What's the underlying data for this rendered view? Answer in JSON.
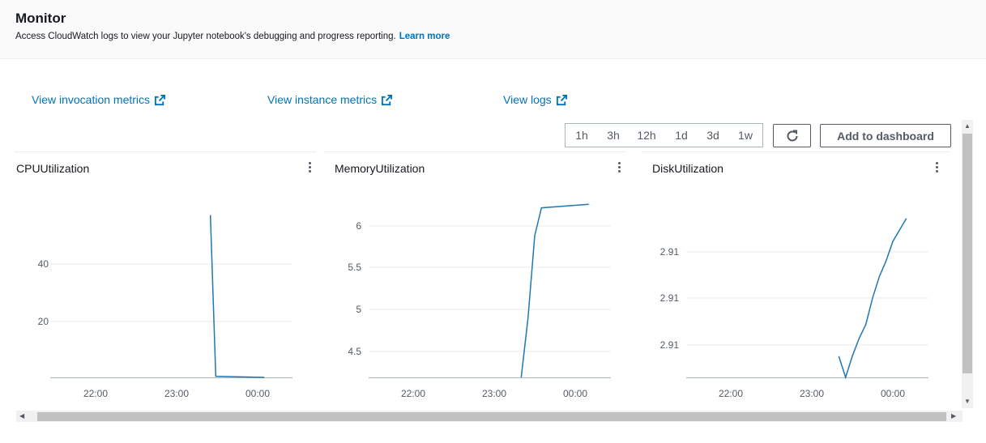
{
  "header": {
    "title": "Monitor",
    "subtitle": "Access CloudWatch logs to view your Jupyter notebook's debugging and progress reporting.",
    "learn_more": "Learn more"
  },
  "links": {
    "invocation": "View invocation metrics",
    "instance": "View instance metrics",
    "logs": "View logs"
  },
  "time_range": [
    "1h",
    "3h",
    "12h",
    "1d",
    "3d",
    "1w"
  ],
  "toolbar": {
    "refresh_icon": "refresh-icon",
    "add_to_dashboard": "Add to dashboard"
  },
  "colors": {
    "line": "#1f77b4",
    "link": "#0073bb"
  },
  "chart_data": [
    {
      "type": "line",
      "title": "CPUUtilization",
      "x_ticks": [
        "22:00",
        "23:00",
        "00:00"
      ],
      "y_ticks": [
        "20",
        "40"
      ],
      "x": [
        "23:25",
        "23:29",
        "00:05"
      ],
      "values": [
        57,
        0.4,
        0
      ],
      "ylim": [
        0,
        62
      ]
    },
    {
      "type": "line",
      "title": "MemoryUtilization",
      "x_ticks": [
        "22:00",
        "23:00",
        "00:00"
      ],
      "y_ticks": [
        "4.5",
        "5",
        "5.5",
        "6"
      ],
      "x": [
        "23:20",
        "23:25",
        "23:30",
        "23:35",
        "00:10"
      ],
      "values": [
        4.17,
        4.85,
        5.8,
        6.12,
        6.16
      ],
      "ylim": [
        4.17,
        6.2
      ]
    },
    {
      "type": "line",
      "title": "DiskUtilization",
      "x_ticks": [
        "22:00",
        "23:00",
        "00:00"
      ],
      "y_ticks": [
        "2.91",
        "2.91",
        "2.91"
      ],
      "x": [
        "23:20",
        "23:25",
        "23:30",
        "23:35",
        "23:40",
        "23:45",
        "23:50",
        "23:55",
        "00:00",
        "00:10"
      ],
      "values": [
        0.12,
        0.0,
        0.12,
        0.22,
        0.3,
        0.45,
        0.57,
        0.66,
        0.77,
        0.9
      ],
      "ylim": [
        0,
        1
      ]
    }
  ]
}
